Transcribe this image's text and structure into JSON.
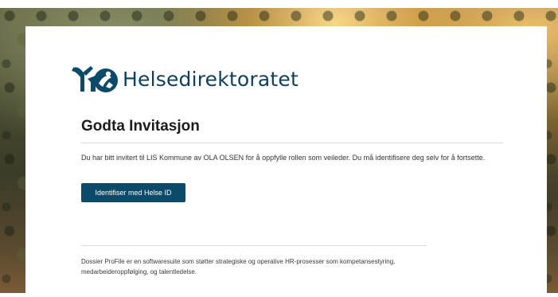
{
  "brand": {
    "name": "Helsedirektoratet",
    "logo_icon": "helsedirektoratet-logo-icon",
    "color": "#0b3f5c"
  },
  "page": {
    "title": "Godta Invitasjon",
    "message": "Du har bitt invitert til LIS Kommune av OLA OLSEN for å oppfylle rollen som veileder. Du må identifisere deg selv for å fortsette."
  },
  "actions": {
    "identify_label": "Identifiser med Helse ID",
    "button_color": "#0c4a6a"
  },
  "footer": {
    "text": "Dossier ProFile er en softwaresuite som støtter strategiske og operative HR-prosesser som kompetansestyring, medarbeideroppfølging, og talentledelse."
  }
}
